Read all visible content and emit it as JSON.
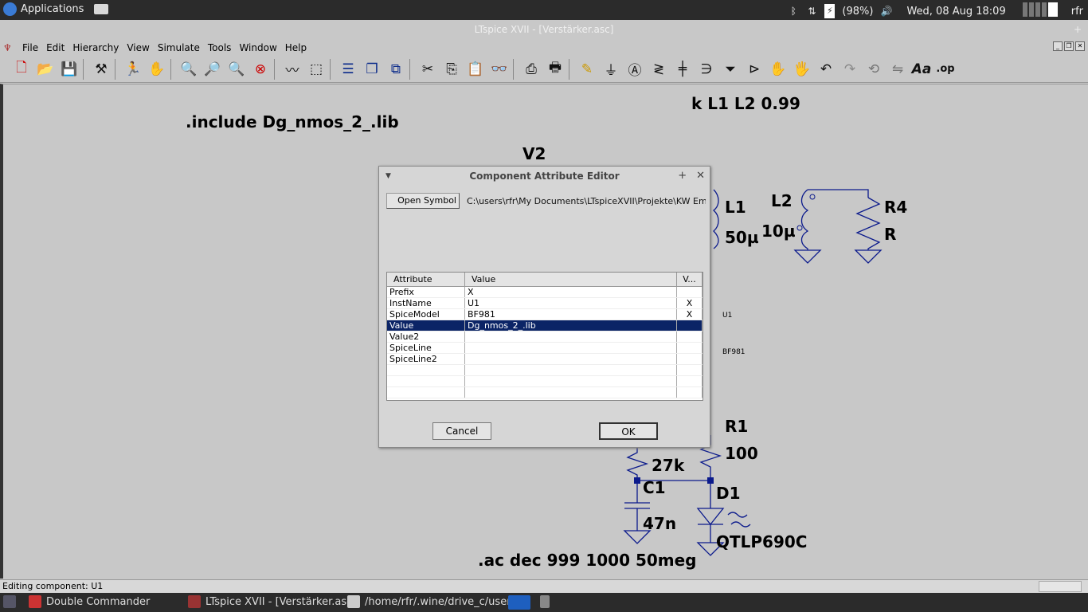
{
  "top_panel": {
    "applications_label": "Applications",
    "battery": "(98%)",
    "datetime": "Wed, 08 Aug  18:09",
    "user": "rfr"
  },
  "window": {
    "title": "LTspice XVII - [Verstärker.asc]"
  },
  "menu": {
    "items": [
      "File",
      "Edit",
      "Hierarchy",
      "View",
      "Simulate",
      "Tools",
      "Window",
      "Help"
    ]
  },
  "toolbar": {
    "buttons": [
      "new-schematic-icon",
      "open-icon",
      "save-icon",
      "control-panel-icon",
      "run-icon",
      "halt-icon",
      "zoom-in-icon",
      "pan-icon",
      "zoom-out-icon",
      "zoom-fit-icon",
      "waveform-icon",
      "autorange-icon",
      "tile-horizontal-icon",
      "cascade-icon",
      "tile-vertical-icon",
      "cut-icon",
      "copy-icon",
      "paste-icon",
      "find-icon",
      "print-setup-icon",
      "print-icon",
      "wire-icon",
      "ground-icon",
      "label-icon",
      "resistor-icon",
      "capacitor-icon",
      "inductor-icon",
      "diode-icon",
      "component-icon",
      "move-icon",
      "drag-icon",
      "undo-icon",
      "redo-icon",
      "rotate-icon",
      "mirror-icon",
      "text-icon",
      "spice-directive-icon"
    ]
  },
  "schematic": {
    "include_directive": ".include Dg_nmos_2_.lib",
    "coupling_directive": "k L1 L2 0.99",
    "ac_directive": ".ac dec 999 1000 50meg",
    "labels": {
      "v2": "V2",
      "l1": "L1",
      "l1_value": "50µ",
      "l2": "L2",
      "l2_value": "10µ",
      "r4": "R4",
      "r4_value": "R",
      "u1": "U1",
      "bf981": "BF981",
      "r1": "R1",
      "r1_value": "100",
      "r_27k": "27k",
      "c1": "C1",
      "c1_value": "47n",
      "d1": "D1",
      "d1_value": "QTLP690C"
    }
  },
  "dialog": {
    "title": "Component Attribute Editor",
    "open_symbol_label": "Open Symbol",
    "symbol_path": "C:\\users\\rfr\\My Documents\\LTspiceXVII\\Projekte\\KW Empf",
    "columns": [
      "Attribute",
      "Value",
      "V..."
    ],
    "rows": [
      {
        "attribute": "Prefix",
        "value": "X",
        "visible": ""
      },
      {
        "attribute": "InstName",
        "value": "U1",
        "visible": "X"
      },
      {
        "attribute": "SpiceModel",
        "value": "BF981",
        "visible": "X"
      },
      {
        "attribute": "Value",
        "value": "Dg_nmos_2_.lib",
        "visible": ""
      },
      {
        "attribute": "Value2",
        "value": "",
        "visible": ""
      },
      {
        "attribute": "SpiceLine",
        "value": "",
        "visible": ""
      },
      {
        "attribute": "SpiceLine2",
        "value": "",
        "visible": ""
      },
      {
        "attribute": "",
        "value": "",
        "visible": ""
      },
      {
        "attribute": "",
        "value": "",
        "visible": ""
      },
      {
        "attribute": "",
        "value": "",
        "visible": ""
      }
    ],
    "selected_row": 3,
    "cancel_label": "Cancel",
    "ok_label": "OK"
  },
  "status": {
    "text": "Editing component: U1"
  },
  "taskbar": {
    "tasks": [
      "Double Commander",
      "LTspice XVII - [Verstärker.asc]",
      "/home/rfr/.wine/drive_c/user..."
    ]
  }
}
